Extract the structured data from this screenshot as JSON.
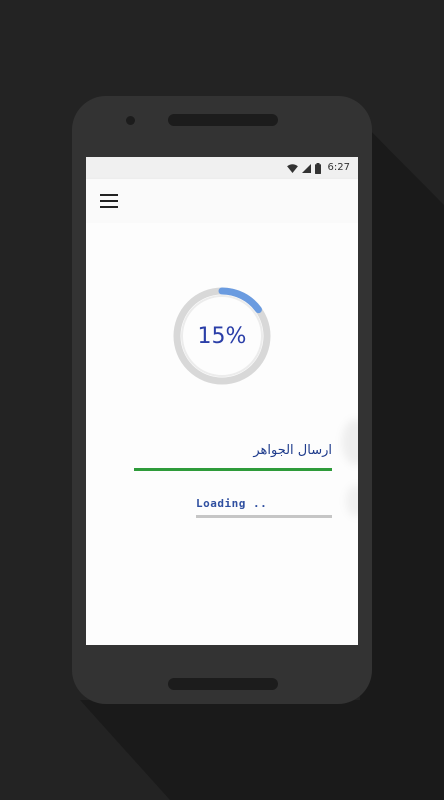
{
  "statusbar": {
    "time": "6:27"
  },
  "progress": {
    "percent_text": "15%",
    "value": 0.15
  },
  "send": {
    "label": "ارسال الجواهر"
  },
  "loading": {
    "label": "Loading .."
  },
  "colors": {
    "progress_track": "#dadada",
    "progress_fill": "#6a9be0",
    "send_bar": "#2e9b3a",
    "loading_bar": "#c6c6c6",
    "text_blue": "#1f3c8c"
  },
  "icons": {
    "menu": "hamburger-menu-icon",
    "wifi": "wifi-icon",
    "signal": "signal-icon",
    "battery": "battery-icon"
  }
}
